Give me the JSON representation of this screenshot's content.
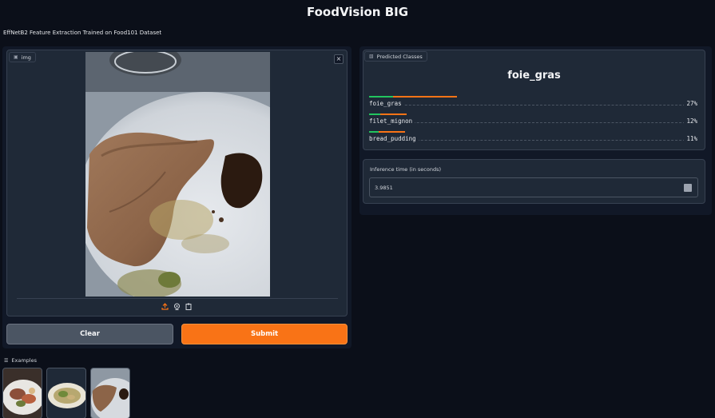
{
  "app": {
    "title": "FoodVision BIG",
    "description": "EffNetB2 Feature Extraction Trained on Food101 Dataset"
  },
  "input": {
    "label": "img",
    "icon": "image-icon",
    "clear_label": "Clear",
    "submit_label": "Submit",
    "tools": [
      "upload-icon",
      "webcam-icon",
      "clipboard-icon"
    ]
  },
  "output": {
    "label": "Predicted Classes",
    "icon": "bar-chart-icon",
    "top_class": "foie_gras",
    "classes": [
      {
        "name": "foie_gras",
        "percent": "27%",
        "confidence": 0.27
      },
      {
        "name": "filet_mignon",
        "percent": "12%",
        "confidence": 0.12
      },
      {
        "name": "bread_pudding",
        "percent": "11%",
        "confidence": 0.11
      }
    ]
  },
  "inference": {
    "label": "Inference time (in seconds)",
    "value": "3.9851"
  },
  "examples": {
    "label": "Examples",
    "icon": "list-icon"
  },
  "colors": {
    "accent": "#f97316",
    "background": "#0b0f19",
    "panel": "#111827",
    "block": "#1f2937"
  }
}
